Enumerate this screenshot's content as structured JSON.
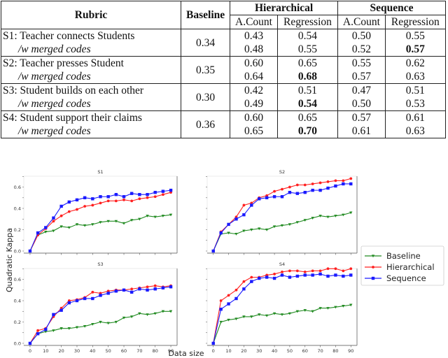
{
  "table": {
    "headers": {
      "rubric": "Rubric",
      "baseline": "Baseline",
      "hierarchical": "Hierarchical",
      "sequence": "Sequence",
      "sub": [
        "A.Count",
        "Regression",
        "A.Count",
        "Regression"
      ]
    },
    "merged_label": "/w merged codes",
    "rows": [
      {
        "rubric": "S1: Teacher connects Students",
        "baseline": "0.34",
        "values": [
          "0.43",
          "0.54",
          "0.50",
          "0.55"
        ],
        "merged_values": [
          "0.48",
          "0.55",
          "0.52",
          "0.57"
        ],
        "merged_bold_index": 3
      },
      {
        "rubric": "S2: Teacher presses Student",
        "baseline": "0.35",
        "values": [
          "0.60",
          "0.65",
          "0.55",
          "0.62"
        ],
        "merged_values": [
          "0.64",
          "0.68",
          "0.57",
          "0.63"
        ],
        "merged_bold_index": 1
      },
      {
        "rubric": "S3: Student builds on each other",
        "baseline": "0.30",
        "values": [
          "0.42",
          "0.51",
          "0.47",
          "0.51"
        ],
        "merged_values": [
          "0.49",
          "0.54",
          "0.50",
          "0.53"
        ],
        "merged_bold_index": 1
      },
      {
        "rubric": "S4: Student support their claims",
        "baseline": "0.36",
        "values": [
          "0.60",
          "0.65",
          "0.57",
          "0.61"
        ],
        "merged_values": [
          "0.65",
          "0.70",
          "0.61",
          "0.63"
        ],
        "merged_bold_index": 1
      }
    ]
  },
  "figure": {
    "ylabel": "Quadratic Kappa",
    "xlabel": "Data size",
    "legend": {
      "placement": "right",
      "entries": [
        {
          "name": "Baseline",
          "color": "#228b22",
          "marker": "triangle-down"
        },
        {
          "name": "Hierarchical",
          "color": "#ff2020",
          "marker": "circle"
        },
        {
          "name": "Sequence",
          "color": "#1a1aff",
          "marker": "square"
        }
      ]
    }
  },
  "chart_data": [
    {
      "type": "line",
      "title": "S1",
      "x": [
        0,
        5,
        10,
        15,
        20,
        25,
        30,
        35,
        40,
        45,
        50,
        55,
        60,
        65,
        70,
        75,
        80,
        85,
        90
      ],
      "xticks": [
        0,
        10,
        20,
        30,
        40,
        50,
        60,
        70,
        80,
        90
      ],
      "yticks": [
        0.0,
        0.2,
        0.4,
        0.6
      ],
      "ylim": [
        0.0,
        0.7
      ],
      "xlim": [
        -4,
        94
      ],
      "show_y_ticklabels": true,
      "show_x_ticklabels": false,
      "series": [
        {
          "name": "Baseline",
          "values": [
            0,
            0.15,
            0.18,
            0.19,
            0.23,
            0.22,
            0.25,
            0.24,
            0.25,
            0.27,
            0.28,
            0.28,
            0.26,
            0.29,
            0.3,
            0.33,
            0.32,
            0.33,
            0.34
          ]
        },
        {
          "name": "Hierarchical",
          "values": [
            0,
            0.15,
            0.21,
            0.28,
            0.33,
            0.37,
            0.39,
            0.42,
            0.43,
            0.45,
            0.47,
            0.47,
            0.48,
            0.47,
            0.49,
            0.5,
            0.51,
            0.53,
            0.55
          ]
        },
        {
          "name": "Sequence",
          "values": [
            0,
            0.17,
            0.22,
            0.31,
            0.42,
            0.46,
            0.48,
            0.5,
            0.49,
            0.51,
            0.51,
            0.53,
            0.51,
            0.54,
            0.53,
            0.53,
            0.55,
            0.56,
            0.57
          ]
        }
      ]
    },
    {
      "type": "line",
      "title": "S2",
      "x": [
        0,
        5,
        10,
        15,
        20,
        25,
        30,
        35,
        40,
        45,
        50,
        55,
        60,
        65,
        70,
        75,
        80,
        85,
        90
      ],
      "xticks": [
        0,
        10,
        20,
        30,
        40,
        50,
        60,
        70,
        80,
        90
      ],
      "yticks": [
        0.0,
        0.2,
        0.4,
        0.6
      ],
      "ylim": [
        0.0,
        0.7
      ],
      "xlim": [
        -4,
        94
      ],
      "show_y_ticklabels": false,
      "show_x_ticklabels": false,
      "series": [
        {
          "name": "Baseline",
          "values": [
            0,
            0.16,
            0.17,
            0.16,
            0.19,
            0.2,
            0.21,
            0.2,
            0.23,
            0.24,
            0.25,
            0.27,
            0.29,
            0.31,
            0.33,
            0.32,
            0.33,
            0.34,
            0.36
          ]
        },
        {
          "name": "Hierarchical",
          "values": [
            0,
            0.18,
            0.25,
            0.32,
            0.43,
            0.45,
            0.5,
            0.52,
            0.56,
            0.58,
            0.6,
            0.62,
            0.62,
            0.63,
            0.64,
            0.65,
            0.66,
            0.66,
            0.68
          ]
        },
        {
          "name": "Sequence",
          "values": [
            0,
            0.17,
            0.25,
            0.3,
            0.34,
            0.43,
            0.49,
            0.5,
            0.51,
            0.51,
            0.55,
            0.54,
            0.55,
            0.57,
            0.57,
            0.59,
            0.61,
            0.63,
            0.63
          ]
        }
      ]
    },
    {
      "type": "line",
      "title": "S3",
      "x": [
        0,
        5,
        10,
        15,
        20,
        25,
        30,
        35,
        40,
        45,
        50,
        55,
        60,
        65,
        70,
        75,
        80,
        85,
        90
      ],
      "xticks": [
        0,
        10,
        20,
        30,
        40,
        50,
        60,
        70,
        80,
        90
      ],
      "yticks": [
        0.0,
        0.2,
        0.4,
        0.6
      ],
      "ylim": [
        0.0,
        0.7
      ],
      "xlim": [
        -4,
        94
      ],
      "show_y_ticklabels": true,
      "show_x_ticklabels": true,
      "series": [
        {
          "name": "Baseline",
          "values": [
            0,
            0.09,
            0.11,
            0.12,
            0.14,
            0.14,
            0.15,
            0.16,
            0.18,
            0.2,
            0.19,
            0.2,
            0.24,
            0.25,
            0.28,
            0.27,
            0.28,
            0.3,
            0.3
          ]
        },
        {
          "name": "Hierarchical",
          "values": [
            0,
            0.12,
            0.14,
            0.25,
            0.33,
            0.4,
            0.41,
            0.43,
            0.48,
            0.47,
            0.49,
            0.5,
            0.5,
            0.51,
            0.52,
            0.53,
            0.54,
            0.53,
            0.54
          ]
        },
        {
          "name": "Sequence",
          "values": [
            0,
            0.09,
            0.13,
            0.27,
            0.31,
            0.38,
            0.4,
            0.42,
            0.42,
            0.45,
            0.47,
            0.49,
            0.5,
            0.48,
            0.51,
            0.5,
            0.51,
            0.52,
            0.53
          ]
        }
      ]
    },
    {
      "type": "line",
      "title": "S4",
      "x": [
        0,
        5,
        10,
        15,
        20,
        25,
        30,
        35,
        40,
        45,
        50,
        55,
        60,
        65,
        70,
        75,
        80,
        85,
        90
      ],
      "xticks": [
        0,
        10,
        20,
        30,
        40,
        50,
        60,
        70,
        80,
        90
      ],
      "yticks": [
        0.0,
        0.2,
        0.4,
        0.6
      ],
      "ylim": [
        0.0,
        0.7
      ],
      "xlim": [
        -4,
        94
      ],
      "show_y_ticklabels": false,
      "show_x_ticklabels": true,
      "series": [
        {
          "name": "Baseline",
          "values": [
            0,
            0.2,
            0.22,
            0.23,
            0.25,
            0.25,
            0.27,
            0.26,
            0.28,
            0.27,
            0.28,
            0.3,
            0.31,
            0.3,
            0.33,
            0.33,
            0.34,
            0.35,
            0.36
          ]
        },
        {
          "name": "Hierarchical",
          "values": [
            0,
            0.4,
            0.45,
            0.5,
            0.58,
            0.62,
            0.62,
            0.64,
            0.65,
            0.67,
            0.68,
            0.68,
            0.67,
            0.68,
            0.68,
            0.7,
            0.7,
            0.68,
            0.7
          ]
        },
        {
          "name": "Sequence",
          "values": [
            0,
            0.32,
            0.37,
            0.42,
            0.51,
            0.58,
            0.61,
            0.62,
            0.61,
            0.64,
            0.62,
            0.63,
            0.64,
            0.64,
            0.65,
            0.63,
            0.64,
            0.63,
            0.64
          ]
        }
      ]
    }
  ]
}
